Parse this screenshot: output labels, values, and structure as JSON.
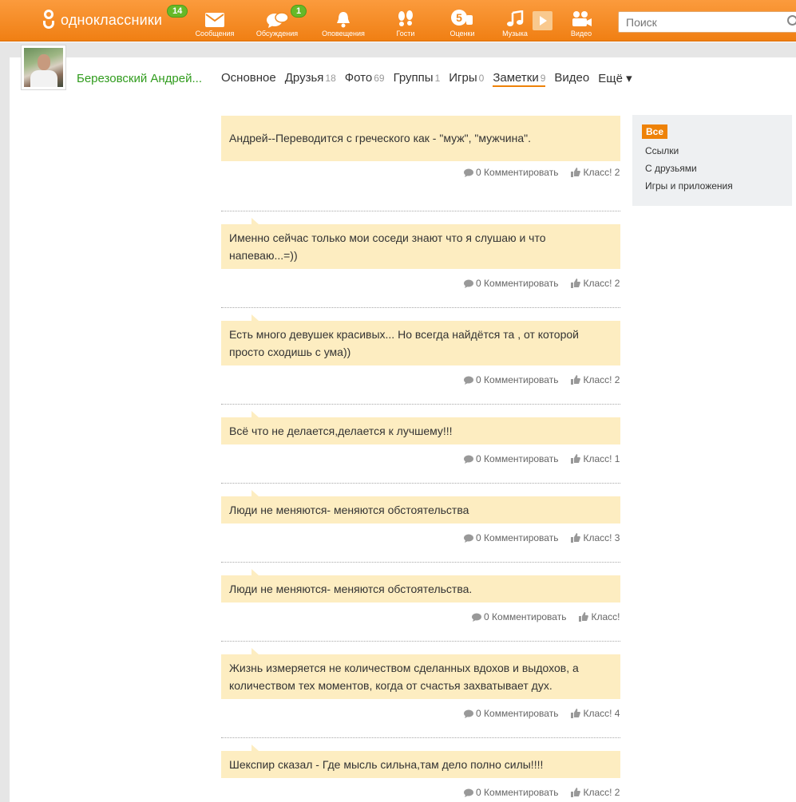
{
  "header": {
    "logo_text": "одноклассники",
    "logo_badge": "14",
    "nav": [
      {
        "label": "Сообщения",
        "icon": "envelope-icon",
        "badge": ""
      },
      {
        "label": "Обсуждения",
        "icon": "discussions-icon",
        "badge": "1"
      },
      {
        "label": "Оповещения",
        "icon": "bell-icon",
        "badge": ""
      },
      {
        "label": "Гости",
        "icon": "footprints-icon",
        "badge": ""
      },
      {
        "label": "Оценки",
        "icon": "rating-5-icon",
        "badge": ""
      },
      {
        "label": "Музыка",
        "icon": "music-note-icon",
        "badge": ""
      },
      {
        "label": "Видео",
        "icon": "video-camera-icon",
        "badge": ""
      }
    ],
    "search_placeholder": "Поиск"
  },
  "profile": {
    "name": "Березовский Андрей...",
    "tabs": [
      {
        "label": "Основное",
        "count": ""
      },
      {
        "label": "Друзья",
        "count": "18"
      },
      {
        "label": "Фото",
        "count": "69"
      },
      {
        "label": "Группы",
        "count": "1"
      },
      {
        "label": "Игры",
        "count": "0"
      },
      {
        "label": "Заметки",
        "count": "9",
        "active": true
      },
      {
        "label": "Видео",
        "count": ""
      },
      {
        "label": "Ещё ▾",
        "count": ""
      }
    ]
  },
  "sidebar": {
    "selected": "Все",
    "items": [
      "Ссылки",
      "С друзьями",
      "Игры и приложения"
    ]
  },
  "notes": [
    {
      "text": "Андрей--Переводится с греческого как - \"муж\", \"мужчина\".",
      "comment_count": "0",
      "comment_label": "Комментировать",
      "like_label": "Класс!",
      "like_count": "2"
    },
    {
      "text": "Именно сейчас только мои соседи знают что я слушаю и что напеваю...=))",
      "comment_count": "0",
      "comment_label": "Комментировать",
      "like_label": "Класс!",
      "like_count": "2"
    },
    {
      "text": "Есть много девушек красивых... Но всегда найдётся та , от которой просто сходишь с ума))",
      "comment_count": "0",
      "comment_label": "Комментировать",
      "like_label": "Класс!",
      "like_count": "2"
    },
    {
      "text": "Всё что не делается,делается к лучшему!!!",
      "comment_count": "0",
      "comment_label": "Комментировать",
      "like_label": "Класс!",
      "like_count": "1"
    },
    {
      "text": "Люди не меняются- меняются обстоятельства",
      "comment_count": "0",
      "comment_label": "Комментировать",
      "like_label": "Класс!",
      "like_count": "3"
    },
    {
      "text": "Люди не меняются- меняются обстоятельства.",
      "comment_count": "0",
      "comment_label": "Комментировать",
      "like_label": "Класс!",
      "like_count": ""
    },
    {
      "text": "Жизнь измеряется не количеством сделанных вдохов и выдохов, а количеством тех моментов, когда от счастья захватывает дух.",
      "comment_count": "0",
      "comment_label": "Комментировать",
      "like_label": "Класс!",
      "like_count": "4"
    },
    {
      "text": "Шекспир  сказал -  Где мысль сильна,там дело полно силы!!!!",
      "comment_count": "0",
      "comment_label": "Комментировать",
      "like_label": "Класс!",
      "like_count": "2"
    }
  ],
  "colors": {
    "brand": "#f07f13",
    "note_bg": "#fdedc1",
    "link_green": "#319c1e",
    "badge_green": "#66b928"
  }
}
